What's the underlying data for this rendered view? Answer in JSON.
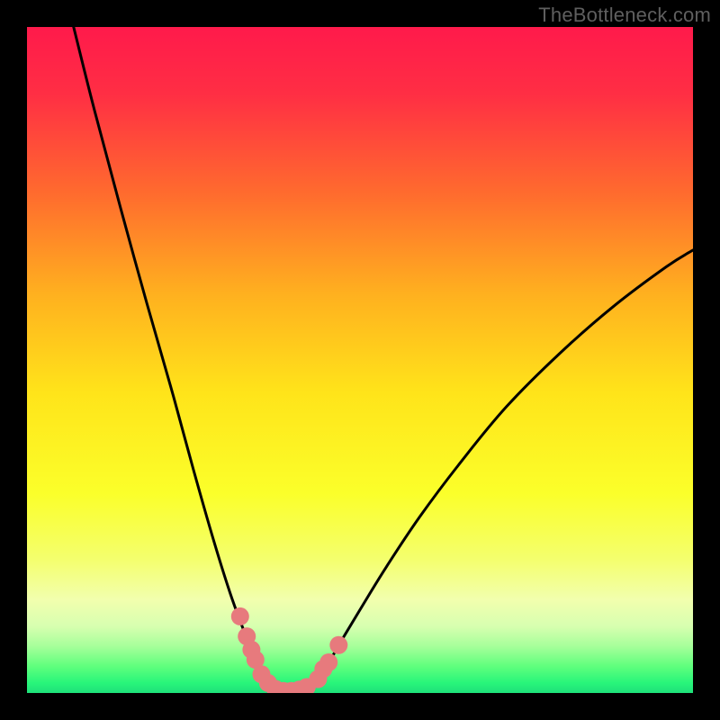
{
  "watermark": "TheBottleneck.com",
  "chart_data": {
    "type": "line",
    "title": "",
    "xlabel": "",
    "ylabel": "",
    "xlim": [
      0,
      100
    ],
    "ylim": [
      0,
      100
    ],
    "grid": false,
    "legend": false,
    "gradient_stops": [
      {
        "offset": 0.0,
        "color": "#ff1a4b"
      },
      {
        "offset": 0.1,
        "color": "#ff2e44"
      },
      {
        "offset": 0.25,
        "color": "#ff6b2e"
      },
      {
        "offset": 0.4,
        "color": "#ffb01f"
      },
      {
        "offset": 0.55,
        "color": "#ffe41a"
      },
      {
        "offset": 0.7,
        "color": "#fbff2a"
      },
      {
        "offset": 0.8,
        "color": "#f4ff6e"
      },
      {
        "offset": 0.86,
        "color": "#f2ffae"
      },
      {
        "offset": 0.9,
        "color": "#d7ffb0"
      },
      {
        "offset": 0.93,
        "color": "#a6ff9a"
      },
      {
        "offset": 0.96,
        "color": "#5fff7d"
      },
      {
        "offset": 0.985,
        "color": "#28f57a"
      },
      {
        "offset": 1.0,
        "color": "#1fe07a"
      }
    ],
    "series": [
      {
        "name": "curve-left",
        "x": [
          7.0,
          10.0,
          14.0,
          18.0,
          22.0,
          25.0,
          28.0,
          30.5,
          32.5,
          34.0,
          35.3,
          36.3,
          37.0
        ],
        "y": [
          100.0,
          88.0,
          73.0,
          58.5,
          44.5,
          33.5,
          23.0,
          15.0,
          9.5,
          5.5,
          2.8,
          1.2,
          0.3
        ]
      },
      {
        "name": "curve-right",
        "x": [
          42.5,
          43.5,
          45.0,
          47.0,
          50.0,
          54.0,
          59.0,
          65.0,
          72.0,
          80.0,
          88.0,
          96.0,
          100.0
        ],
        "y": [
          0.6,
          1.8,
          4.0,
          7.5,
          12.5,
          19.0,
          26.5,
          34.5,
          43.0,
          51.0,
          58.0,
          64.0,
          66.5
        ]
      },
      {
        "name": "flat-bridge",
        "x": [
          37.0,
          38.5,
          40.0,
          41.2,
          42.5
        ],
        "y": [
          0.3,
          0.15,
          0.1,
          0.15,
          0.6
        ]
      }
    ],
    "pink_markers": {
      "color": "#e77a7d",
      "size": 10,
      "left_cluster": {
        "x": [
          32.0,
          33.0,
          33.7,
          34.3
        ],
        "y": [
          11.5,
          8.5,
          6.5,
          5.0
        ]
      },
      "bottom_chain": {
        "x": [
          35.2,
          36.2,
          37.3,
          38.5,
          39.7,
          40.9,
          42.0
        ],
        "y": [
          2.8,
          1.5,
          0.6,
          0.3,
          0.3,
          0.5,
          0.9
        ]
      },
      "right_cluster": {
        "x": [
          43.7,
          44.5,
          45.3
        ],
        "y": [
          2.1,
          3.6,
          4.6
        ]
      },
      "right_outlier": {
        "x": [
          46.8
        ],
        "y": [
          7.2
        ]
      }
    }
  }
}
